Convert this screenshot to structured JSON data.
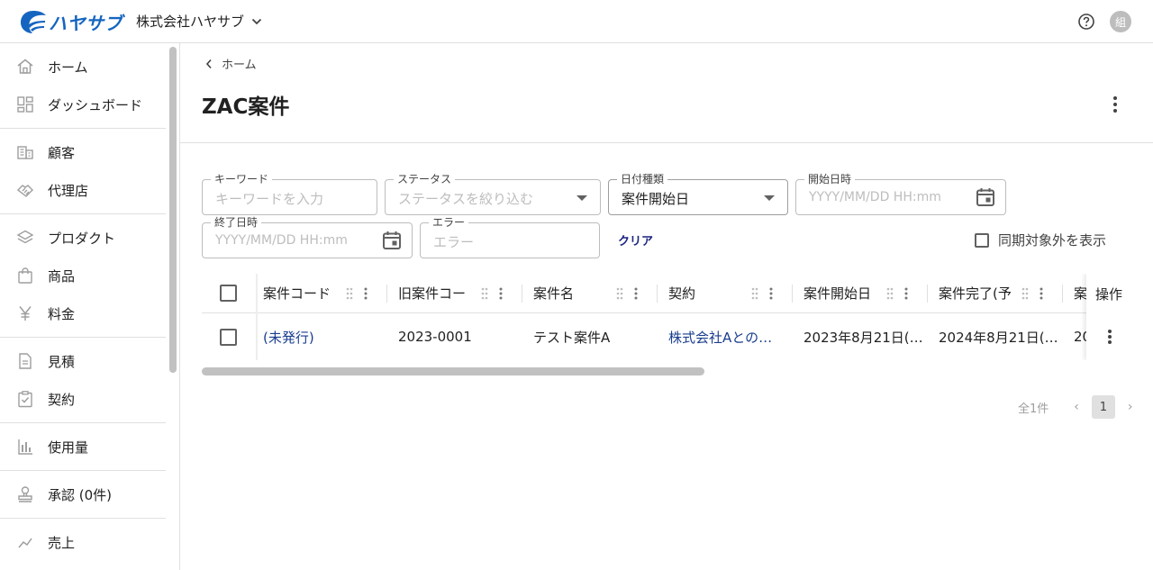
{
  "header": {
    "logo_text": "ハヤサブ",
    "company": "株式会社ハヤサブ",
    "avatar": "組"
  },
  "sidebar": {
    "groups": [
      [
        {
          "label": "ホーム",
          "icon": "home-icon"
        },
        {
          "label": "ダッシュボード",
          "icon": "dashboard-icon"
        }
      ],
      [
        {
          "label": "顧客",
          "icon": "building-icon"
        },
        {
          "label": "代理店",
          "icon": "handshake-icon"
        }
      ],
      [
        {
          "label": "プロダクト",
          "icon": "layers-icon"
        },
        {
          "label": "商品",
          "icon": "bag-icon"
        },
        {
          "label": "料金",
          "icon": "yen-icon"
        }
      ],
      [
        {
          "label": "見積",
          "icon": "document-icon"
        },
        {
          "label": "契約",
          "icon": "clipboard-check-icon"
        }
      ],
      [
        {
          "label": "使用量",
          "icon": "bar-chart-icon"
        }
      ],
      [
        {
          "label": "承認 (0件)",
          "icon": "stamp-icon"
        }
      ],
      [
        {
          "label": "売上",
          "icon": "sales-icon"
        }
      ]
    ]
  },
  "main": {
    "breadcrumb": "ホーム",
    "title": "ZAC案件",
    "filters": {
      "keyword": {
        "label": "キーワード",
        "placeholder": "キーワードを入力"
      },
      "status": {
        "label": "ステータス",
        "placeholder": "ステータスを絞り込む"
      },
      "date_type": {
        "label": "日付種類",
        "value": "案件開始日"
      },
      "start": {
        "label": "開始日時",
        "placeholder": "YYYY/MM/DD HH:mm"
      },
      "end": {
        "label": "終了日時",
        "placeholder": "YYYY/MM/DD HH:mm"
      },
      "error": {
        "label": "エラー",
        "placeholder": "エラー"
      },
      "clear": "クリア",
      "show_excluded": "同期対象外を表示"
    },
    "table": {
      "columns": [
        "案件コード",
        "旧案件コー",
        "案件名",
        "契約",
        "案件開始日",
        "案件完了(予",
        "案",
        "操作"
      ],
      "rows": [
        [
          "(未発行)",
          "2023-0001",
          "テスト案件A",
          "株式会社Aとの…",
          "2023年8月21日(…",
          "2024年8月21日(…",
          "20"
        ]
      ]
    },
    "pager": {
      "total": "全1件",
      "prev": "‹",
      "page": "1",
      "next": "›"
    }
  }
}
